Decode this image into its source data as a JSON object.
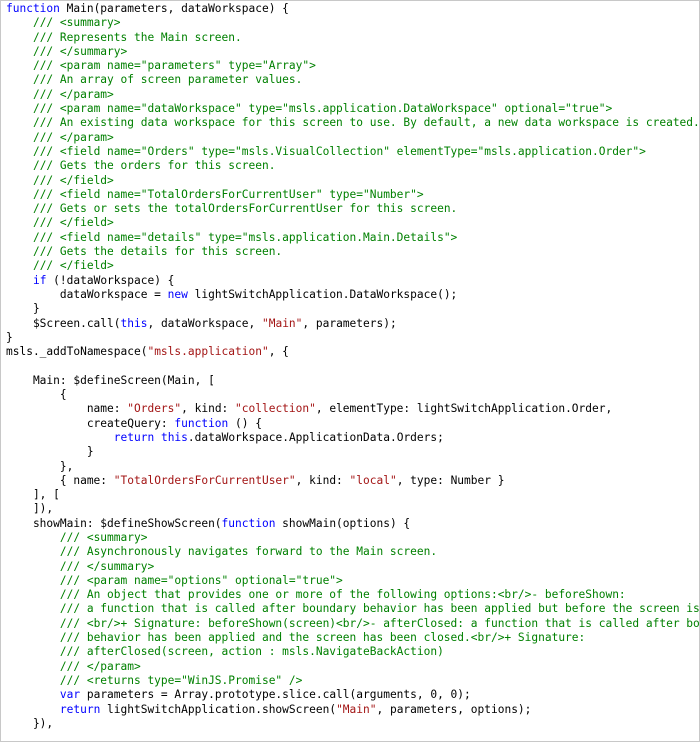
{
  "colors": {
    "keyword": "#0000ff",
    "comment": "#008000",
    "string": "#a31515",
    "plain": "#000000",
    "background": "#ffffff",
    "border": "#c8c8c8"
  },
  "lines": [
    [
      [
        "kw",
        "function"
      ],
      [
        "pl",
        " Main(parameters, dataWorkspace) {"
      ]
    ],
    [
      [
        "pl",
        "    "
      ],
      [
        "cm",
        "/// <summary>"
      ]
    ],
    [
      [
        "pl",
        "    "
      ],
      [
        "cm",
        "/// Represents the Main screen."
      ]
    ],
    [
      [
        "pl",
        "    "
      ],
      [
        "cm",
        "/// </summary>"
      ]
    ],
    [
      [
        "pl",
        "    "
      ],
      [
        "cm",
        "/// <param name=\"parameters\" type=\"Array\">"
      ]
    ],
    [
      [
        "pl",
        "    "
      ],
      [
        "cm",
        "/// An array of screen parameter values."
      ]
    ],
    [
      [
        "pl",
        "    "
      ],
      [
        "cm",
        "/// </param>"
      ]
    ],
    [
      [
        "pl",
        "    "
      ],
      [
        "cm",
        "/// <param name=\"dataWorkspace\" type=\"msls.application.DataWorkspace\" optional=\"true\">"
      ]
    ],
    [
      [
        "pl",
        "    "
      ],
      [
        "cm",
        "/// An existing data workspace for this screen to use. By default, a new data workspace is created."
      ]
    ],
    [
      [
        "pl",
        "    "
      ],
      [
        "cm",
        "/// </param>"
      ]
    ],
    [
      [
        "pl",
        "    "
      ],
      [
        "cm",
        "/// <field name=\"Orders\" type=\"msls.VisualCollection\" elementType=\"msls.application.Order\">"
      ]
    ],
    [
      [
        "pl",
        "    "
      ],
      [
        "cm",
        "/// Gets the orders for this screen."
      ]
    ],
    [
      [
        "pl",
        "    "
      ],
      [
        "cm",
        "/// </field>"
      ]
    ],
    [
      [
        "pl",
        "    "
      ],
      [
        "cm",
        "/// <field name=\"TotalOrdersForCurrentUser\" type=\"Number\">"
      ]
    ],
    [
      [
        "pl",
        "    "
      ],
      [
        "cm",
        "/// Gets or sets the totalOrdersForCurrentUser for this screen."
      ]
    ],
    [
      [
        "pl",
        "    "
      ],
      [
        "cm",
        "/// </field>"
      ]
    ],
    [
      [
        "pl",
        "    "
      ],
      [
        "cm",
        "/// <field name=\"details\" type=\"msls.application.Main.Details\">"
      ]
    ],
    [
      [
        "pl",
        "    "
      ],
      [
        "cm",
        "/// Gets the details for this screen."
      ]
    ],
    [
      [
        "pl",
        "    "
      ],
      [
        "cm",
        "/// </field>"
      ]
    ],
    [
      [
        "pl",
        "    "
      ],
      [
        "kw",
        "if"
      ],
      [
        "pl",
        " (!dataWorkspace) {"
      ]
    ],
    [
      [
        "pl",
        "        dataWorkspace = "
      ],
      [
        "kw",
        "new"
      ],
      [
        "pl",
        " lightSwitchApplication.DataWorkspace();"
      ]
    ],
    [
      [
        "pl",
        "    }"
      ]
    ],
    [
      [
        "pl",
        "    $Screen.call("
      ],
      [
        "kw",
        "this"
      ],
      [
        "pl",
        ", dataWorkspace, "
      ],
      [
        "str",
        "\"Main\""
      ],
      [
        "pl",
        ", parameters);"
      ]
    ],
    [
      [
        "pl",
        "}"
      ]
    ],
    [
      [
        "pl",
        "msls._addToNamespace("
      ],
      [
        "str",
        "\"msls.application\""
      ],
      [
        "pl",
        ", {"
      ]
    ],
    [
      [
        "pl",
        ""
      ]
    ],
    [
      [
        "pl",
        "    Main: $defineScreen(Main, ["
      ]
    ],
    [
      [
        "pl",
        "        {"
      ]
    ],
    [
      [
        "pl",
        "            name: "
      ],
      [
        "str",
        "\"Orders\""
      ],
      [
        "pl",
        ", kind: "
      ],
      [
        "str",
        "\"collection\""
      ],
      [
        "pl",
        ", elementType: lightSwitchApplication.Order,"
      ]
    ],
    [
      [
        "pl",
        "            createQuery: "
      ],
      [
        "kw",
        "function"
      ],
      [
        "pl",
        " () {"
      ]
    ],
    [
      [
        "pl",
        "                "
      ],
      [
        "kw",
        "return"
      ],
      [
        "pl",
        " "
      ],
      [
        "kw",
        "this"
      ],
      [
        "pl",
        ".dataWorkspace.ApplicationData.Orders;"
      ]
    ],
    [
      [
        "pl",
        "            }"
      ]
    ],
    [
      [
        "pl",
        "        },"
      ]
    ],
    [
      [
        "pl",
        "        { name: "
      ],
      [
        "str",
        "\"TotalOrdersForCurrentUser\""
      ],
      [
        "pl",
        ", kind: "
      ],
      [
        "str",
        "\"local\""
      ],
      [
        "pl",
        ", type: Number }"
      ]
    ],
    [
      [
        "pl",
        "    ], ["
      ]
    ],
    [
      [
        "pl",
        "    ]),"
      ]
    ],
    [
      [
        "pl",
        "    showMain: $defineShowScreen("
      ],
      [
        "kw",
        "function"
      ],
      [
        "pl",
        " showMain(options) {"
      ]
    ],
    [
      [
        "pl",
        "        "
      ],
      [
        "cm",
        "/// <summary>"
      ]
    ],
    [
      [
        "pl",
        "        "
      ],
      [
        "cm",
        "/// Asynchronously navigates forward to the Main screen."
      ]
    ],
    [
      [
        "pl",
        "        "
      ],
      [
        "cm",
        "/// </summary>"
      ]
    ],
    [
      [
        "pl",
        "        "
      ],
      [
        "cm",
        "/// <param name=\"options\" optional=\"true\">"
      ]
    ],
    [
      [
        "pl",
        "        "
      ],
      [
        "cm",
        "/// An object that provides one or more of the following options:<br/>- beforeShown:"
      ]
    ],
    [
      [
        "pl",
        "        "
      ],
      [
        "cm",
        "/// a function that is called after boundary behavior has been applied but before the screen is shown."
      ]
    ],
    [
      [
        "pl",
        "        "
      ],
      [
        "cm",
        "/// <br/>+ Signature: beforeShown(screen)<br/>- afterClosed: a function that is called after boundary"
      ]
    ],
    [
      [
        "pl",
        "        "
      ],
      [
        "cm",
        "/// behavior has been applied and the screen has been closed.<br/>+ Signature:"
      ]
    ],
    [
      [
        "pl",
        "        "
      ],
      [
        "cm",
        "/// afterClosed(screen, action : msls.NavigateBackAction)"
      ]
    ],
    [
      [
        "pl",
        "        "
      ],
      [
        "cm",
        "/// </param>"
      ]
    ],
    [
      [
        "pl",
        "        "
      ],
      [
        "cm",
        "/// <returns type=\"WinJS.Promise\" />"
      ]
    ],
    [
      [
        "pl",
        "        "
      ],
      [
        "kw",
        "var"
      ],
      [
        "pl",
        " parameters = Array.prototype.slice.call(arguments, 0, 0);"
      ]
    ],
    [
      [
        "pl",
        "        "
      ],
      [
        "kw",
        "return"
      ],
      [
        "pl",
        " lightSwitchApplication.showScreen("
      ],
      [
        "str",
        "\"Main\""
      ],
      [
        "pl",
        ", parameters, options);"
      ]
    ],
    [
      [
        "pl",
        "    }),"
      ]
    ]
  ]
}
